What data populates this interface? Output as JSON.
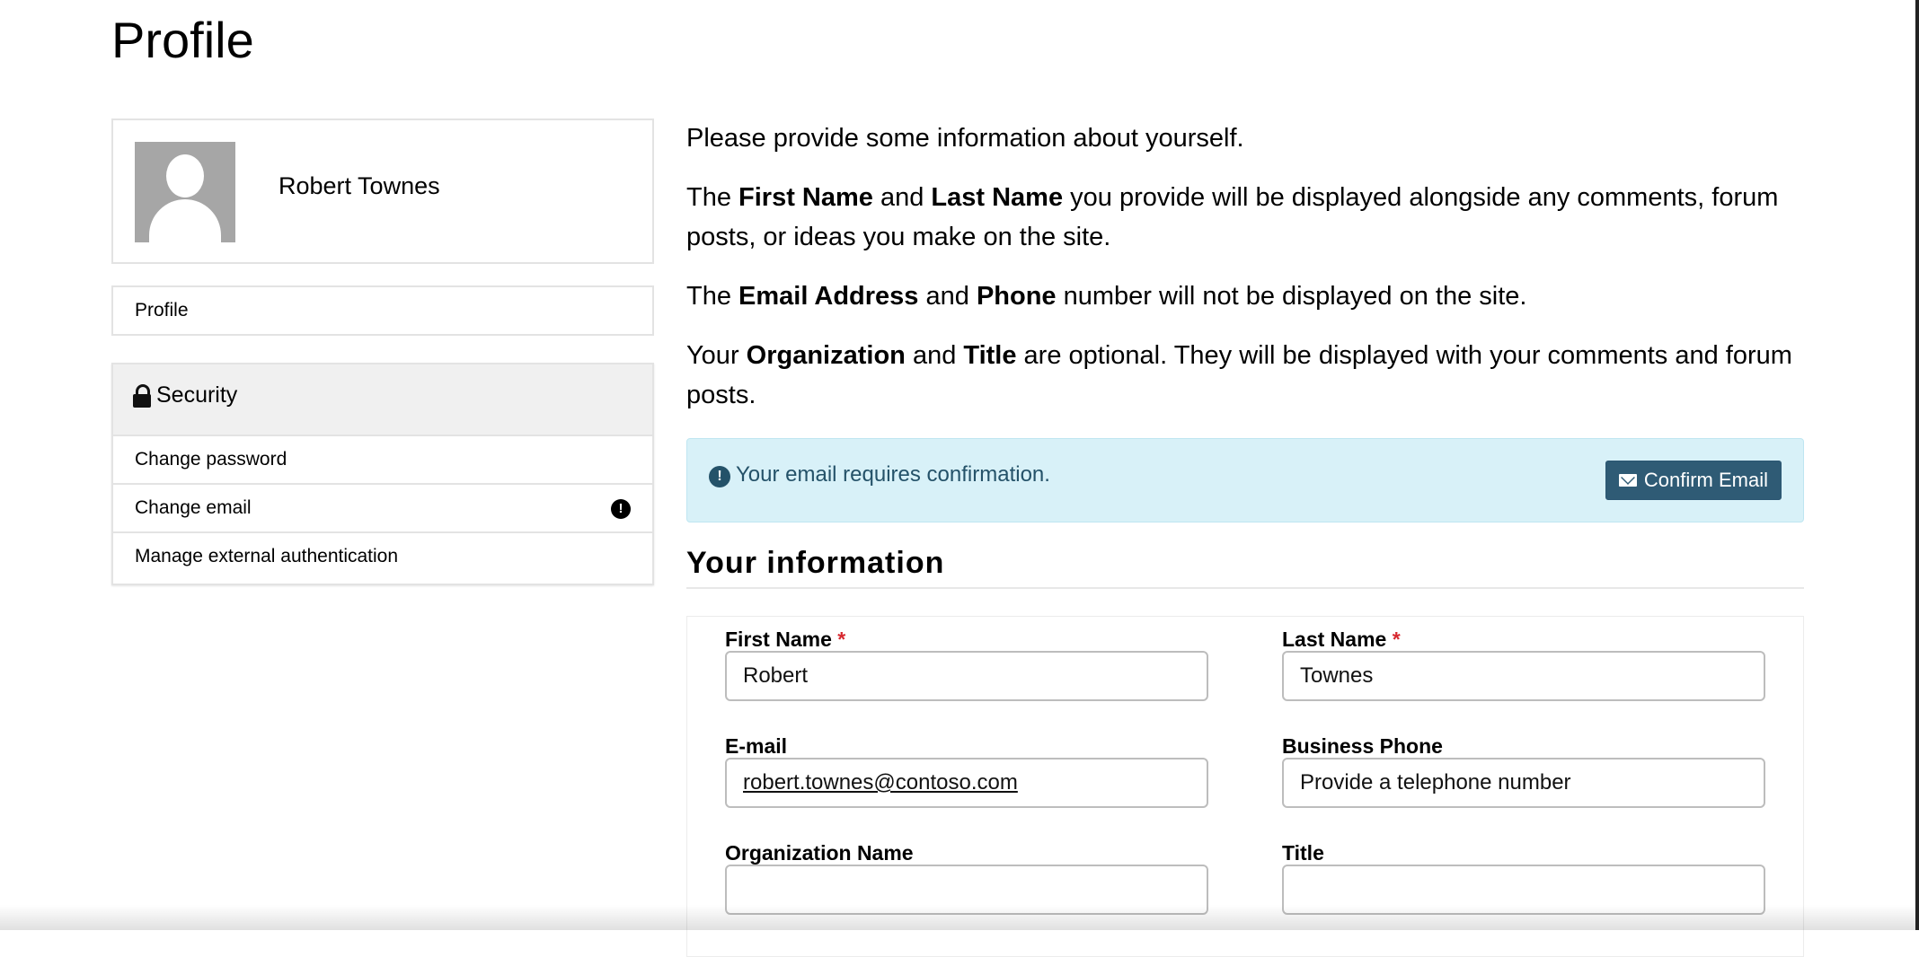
{
  "page": {
    "title": "Profile"
  },
  "sidebar": {
    "user_name": "Robert Townes",
    "profile_link": "Profile",
    "security": {
      "title": "Security",
      "items": [
        {
          "label": "Change password"
        },
        {
          "label": "Change email",
          "alert": "!"
        },
        {
          "label": "Manage external authentication"
        }
      ]
    }
  },
  "intro": {
    "p1": "Please provide some information about yourself.",
    "p2": {
      "a": "The ",
      "b1": "First Name",
      "c": " and ",
      "b2": "Last Name",
      "d": " you provide will be displayed alongside any comments, forum posts, or ideas you make on the site."
    },
    "p3": {
      "a": "The ",
      "b1": "Email Address",
      "c": " and ",
      "b2": "Phone",
      "d": " number will not be displayed on the site."
    },
    "p4": {
      "a": "Your ",
      "b1": "Organization",
      "c": " and ",
      "b2": "Title",
      "d": " are optional. They will be displayed with your comments and forum posts."
    }
  },
  "confirm": {
    "icon": "!",
    "text": "Your email requires confirmation.",
    "button": "Confirm Email"
  },
  "form": {
    "section_title": "Your information",
    "required_mark": "*",
    "first_name": {
      "label": "First Name",
      "value": "Robert"
    },
    "last_name": {
      "label": "Last Name",
      "value": "Townes"
    },
    "email": {
      "label": "E-mail",
      "value": "robert.townes@contoso.com"
    },
    "phone": {
      "label": "Business Phone",
      "placeholder": "Provide a telephone number"
    },
    "organization": {
      "label": "Organization Name",
      "value": ""
    },
    "title": {
      "label": "Title",
      "value": ""
    }
  }
}
